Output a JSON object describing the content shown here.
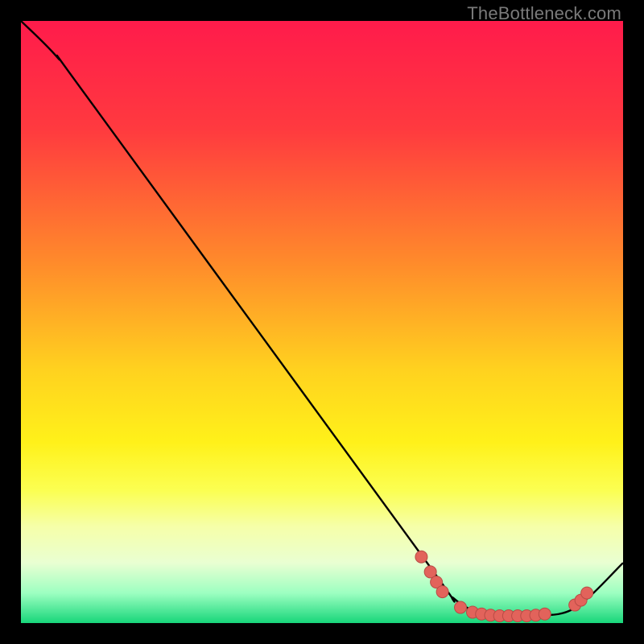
{
  "watermark": {
    "text": "TheBottleneck.com"
  },
  "colors": {
    "bg": "#000000",
    "curve": "#000000",
    "dot_fill": "#e2635b",
    "dot_stroke": "#b94b45"
  },
  "chart_data": {
    "type": "line",
    "title": "",
    "xlabel": "",
    "ylabel": "",
    "xlim": [
      0,
      100
    ],
    "ylim": [
      0,
      100
    ],
    "gradient_stops": [
      {
        "pct": 0,
        "color": "#ff1b4b"
      },
      {
        "pct": 18,
        "color": "#ff3a3f"
      },
      {
        "pct": 40,
        "color": "#ff8a2b"
      },
      {
        "pct": 58,
        "color": "#ffd21f"
      },
      {
        "pct": 70,
        "color": "#fff11a"
      },
      {
        "pct": 78,
        "color": "#fbff52"
      },
      {
        "pct": 84,
        "color": "#f6ffa9"
      },
      {
        "pct": 90,
        "color": "#e9ffd2"
      },
      {
        "pct": 95,
        "color": "#9dffc1"
      },
      {
        "pct": 100,
        "color": "#17d67a"
      }
    ],
    "series": [
      {
        "name": "bottleneck-curve",
        "points": [
          {
            "x": 0,
            "y": 100
          },
          {
            "x": 6,
            "y": 94
          },
          {
            "x": 12,
            "y": 86
          },
          {
            "x": 66,
            "y": 12
          },
          {
            "x": 72,
            "y": 4
          },
          {
            "x": 78,
            "y": 1.3
          },
          {
            "x": 85,
            "y": 1.2
          },
          {
            "x": 92,
            "y": 2.5
          },
          {
            "x": 100,
            "y": 10
          }
        ]
      }
    ],
    "dots": [
      {
        "x": 66.5,
        "y": 11.0
      },
      {
        "x": 68.0,
        "y": 8.5
      },
      {
        "x": 69.0,
        "y": 6.8
      },
      {
        "x": 70.0,
        "y": 5.2
      },
      {
        "x": 73.0,
        "y": 2.6
      },
      {
        "x": 75.0,
        "y": 1.8
      },
      {
        "x": 76.5,
        "y": 1.5
      },
      {
        "x": 78.0,
        "y": 1.3
      },
      {
        "x": 79.5,
        "y": 1.2
      },
      {
        "x": 81.0,
        "y": 1.2
      },
      {
        "x": 82.5,
        "y": 1.2
      },
      {
        "x": 84.0,
        "y": 1.2
      },
      {
        "x": 85.5,
        "y": 1.3
      },
      {
        "x": 87.0,
        "y": 1.5
      },
      {
        "x": 92.0,
        "y": 3.0
      },
      {
        "x": 93.0,
        "y": 3.8
      },
      {
        "x": 94.0,
        "y": 5.0
      }
    ]
  }
}
